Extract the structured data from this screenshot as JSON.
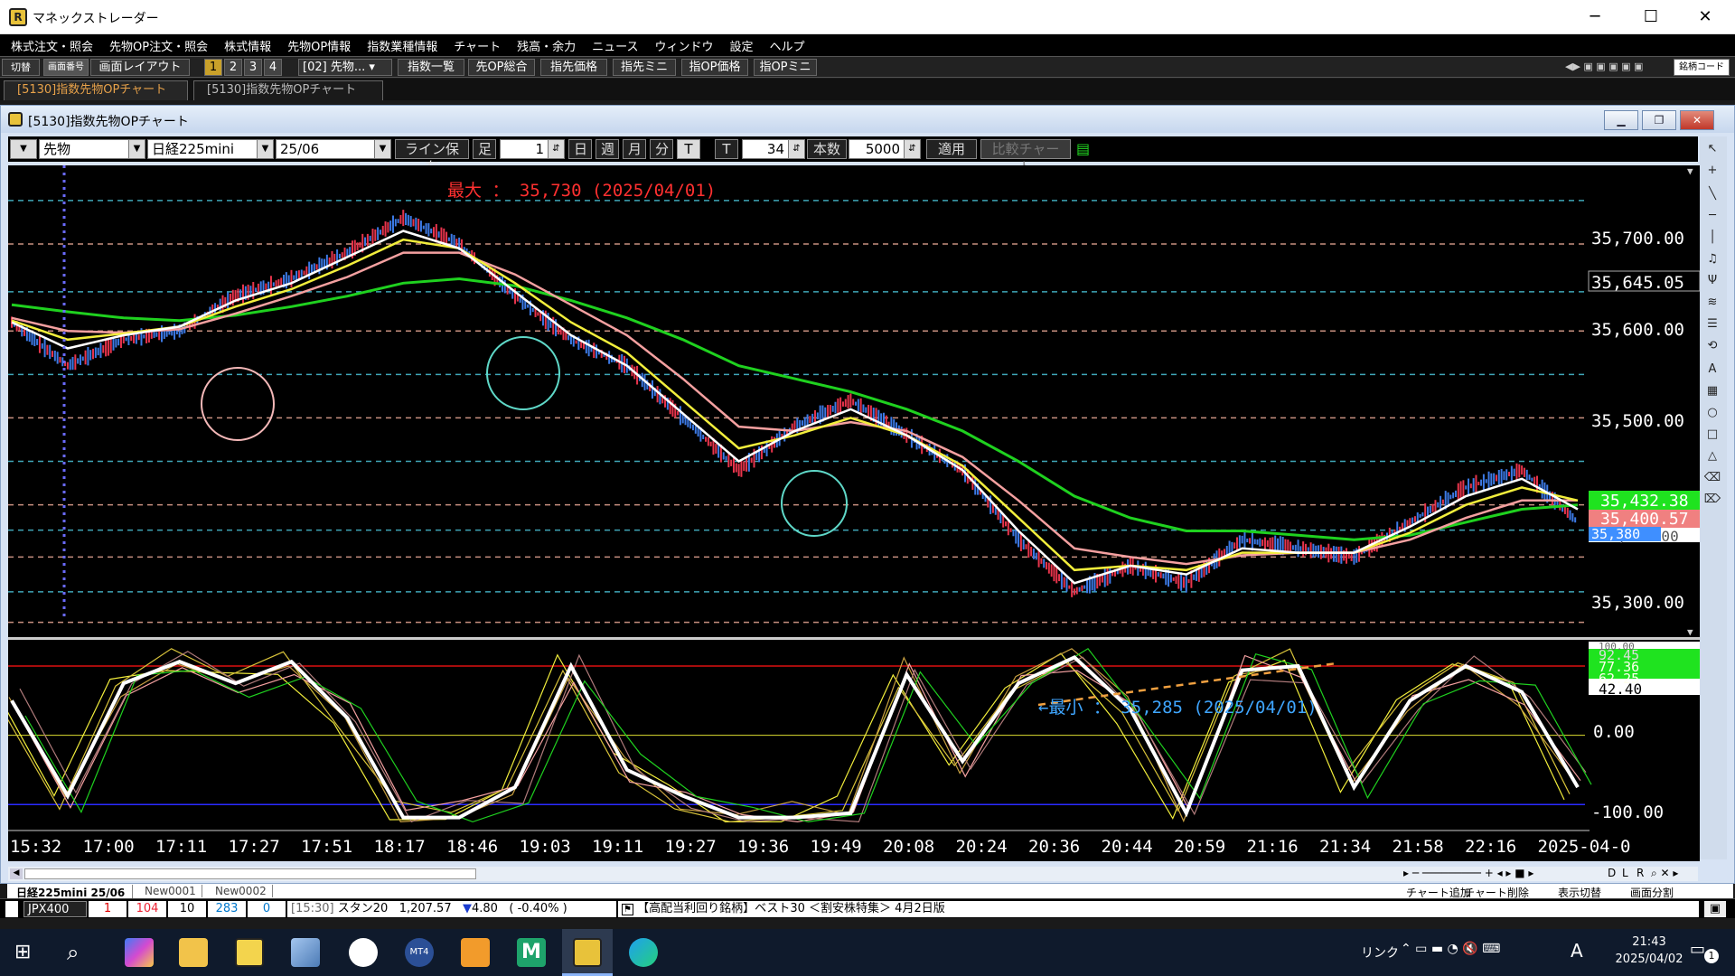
{
  "window": {
    "title": "マネックストレーダー",
    "controls": [
      "─",
      "☐",
      "✕"
    ]
  },
  "menu": [
    "株式注文・照会",
    "先物OP注文・照会",
    "株式情報",
    "先物OP情報",
    "指数業種情報",
    "チャート",
    "残高・余力",
    "ニュース",
    "ウィンドウ",
    "設定",
    "ヘルプ"
  ],
  "toolbar": {
    "switch_label": "切替",
    "screen_no_label": "画面番号",
    "layout_label": "画面レイアウト",
    "layout_numbers": [
      "1",
      "2",
      "3",
      "4"
    ],
    "preset": "[02] 先物...",
    "buttons": [
      "指数一覧",
      "先OP総合",
      "指先価格",
      "指先ミニ",
      "指OP価格",
      "指OPミニ"
    ],
    "search_label": "銘柄コード"
  },
  "tabs": [
    "[5130]指数先物OPチャート",
    "[5130]指数先物OPチャート"
  ],
  "chart_window": {
    "title": "[5130]指数先物OPチャート",
    "controls": {
      "instrument_type": "先物",
      "instrument": "日経225mini",
      "contract": "25/06",
      "line_save": "ライン保存",
      "foot_label": "足",
      "foot_value": "1",
      "periods": [
        "日",
        "週",
        "月",
        "分",
        "T"
      ],
      "t_label": "T",
      "t_value": "34",
      "count_label": "本数",
      "count_value": "5000",
      "apply": "適用",
      "compare": "比較チャート"
    },
    "annotations": {
      "max_label": "最大 ： 35,730 (2025/04/01)",
      "min_label": "←最小 ： 35,285 (2025/04/01)"
    },
    "price_axis": {
      "ticks": [
        "35,700.00",
        "35,600.00",
        "35,500.00",
        "35,300.00"
      ],
      "highlight_dashed": "35,645.05",
      "badge_green": "35,432.38",
      "badge_pink": "35,400.57",
      "badge_blue": "35,380",
      "partial": "35,371.00"
    },
    "oscillator_axis": {
      "ticks": [
        "0.00",
        "-100.00"
      ],
      "top_partial": "100.00",
      "badges": [
        "92.45",
        "77.36",
        "62.25",
        "42.40"
      ]
    },
    "time_axis": [
      "15:32",
      "17:00",
      "17:11",
      "17:27",
      "17:51",
      "18:17",
      "18:46",
      "19:03",
      "19:11",
      "19:27",
      "19:36",
      "19:49",
      "20:08",
      "20:24",
      "20:36",
      "20:44",
      "20:59",
      "21:16",
      "21:34",
      "21:58",
      "22:16",
      "2025-04-0"
    ],
    "bottom_tabs": [
      "日経225mini 25/06",
      "New0001",
      "New0002"
    ],
    "bottom_right_buttons": [
      "チャート追加",
      "チャート削除",
      "表示切替",
      "画面分割"
    ],
    "nav_buttons": [
      "D",
      "L",
      "R"
    ]
  },
  "ticker": {
    "index": "JPX400",
    "values": [
      "1",
      "104",
      "10",
      "283",
      "0"
    ],
    "time_tag": "[15:30]",
    "name": "スタン20",
    "price": "1,207.57",
    "change": "4.80",
    "change_pct": "( -0.40% )",
    "news": "【高配当利回り銘柄】ベスト30 ＜割安株特集＞ 4月2日版"
  },
  "taskbar": {
    "tray_label": "リンク",
    "ime": "A",
    "time": "21:43",
    "date": "2025/04/02",
    "notifications": "1"
  },
  "chart_data": {
    "type": "line",
    "title": "",
    "price_range": [
      35250,
      35780
    ],
    "series": [
      {
        "name": "",
        "color": "#3c7ae6",
        "values": [
          35610,
          35560,
          35590,
          35600,
          35640,
          35660,
          35690,
          35730,
          35700,
          35640,
          35590,
          35560,
          35500,
          35440,
          35490,
          35520,
          35480,
          35440,
          35360,
          35300,
          35330,
          35310,
          35360,
          35350,
          35340,
          35380,
          35420,
          35440,
          35380
        ]
      }
    ],
    "moving_averages": [
      {
        "color": "#ffffff",
        "values": [
          35610,
          35580,
          35595,
          35605,
          35635,
          35655,
          35685,
          35715,
          35695,
          35645,
          35595,
          35560,
          35505,
          35450,
          35485,
          35510,
          35480,
          35440,
          35370,
          35310,
          35330,
          35320,
          35350,
          35345,
          35345,
          35375,
          35410,
          35430,
          35395
        ]
      },
      {
        "color": "#f2ee3c",
        "values": [
          35612,
          35590,
          35597,
          35605,
          35628,
          35648,
          35675,
          35705,
          35695,
          35655,
          35610,
          35575,
          35520,
          35465,
          35480,
          35500,
          35480,
          35445,
          35385,
          35325,
          35330,
          35325,
          35345,
          35345,
          35345,
          35368,
          35400,
          35420,
          35405
        ]
      },
      {
        "color": "#f4a0a0",
        "values": [
          35615,
          35600,
          35598,
          35602,
          35620,
          35640,
          35662,
          35690,
          35690,
          35665,
          35630,
          35595,
          35545,
          35490,
          35485,
          35495,
          35485,
          35455,
          35405,
          35350,
          35340,
          35332,
          35342,
          35345,
          35345,
          35360,
          35385,
          35405,
          35405
        ]
      },
      {
        "color": "#1fd11f",
        "values": [
          35630,
          35622,
          35615,
          35612,
          35618,
          35628,
          35640,
          35655,
          35660,
          35652,
          35635,
          35615,
          35590,
          35560,
          35545,
          35530,
          35510,
          35485,
          35450,
          35410,
          35385,
          35370,
          35370,
          35365,
          35360,
          35365,
          35380,
          35395,
          35400
        ]
      }
    ],
    "oscillator": {
      "range": [
        -110,
        105
      ],
      "white_line": [
        40,
        -70,
        60,
        85,
        60,
        85,
        20,
        -95,
        -95,
        -60,
        80,
        -40,
        -70,
        -95,
        -95,
        -90,
        70,
        -30,
        60,
        90,
        30,
        -90,
        75,
        80,
        -60,
        40,
        80,
        50,
        -60
      ]
    }
  }
}
